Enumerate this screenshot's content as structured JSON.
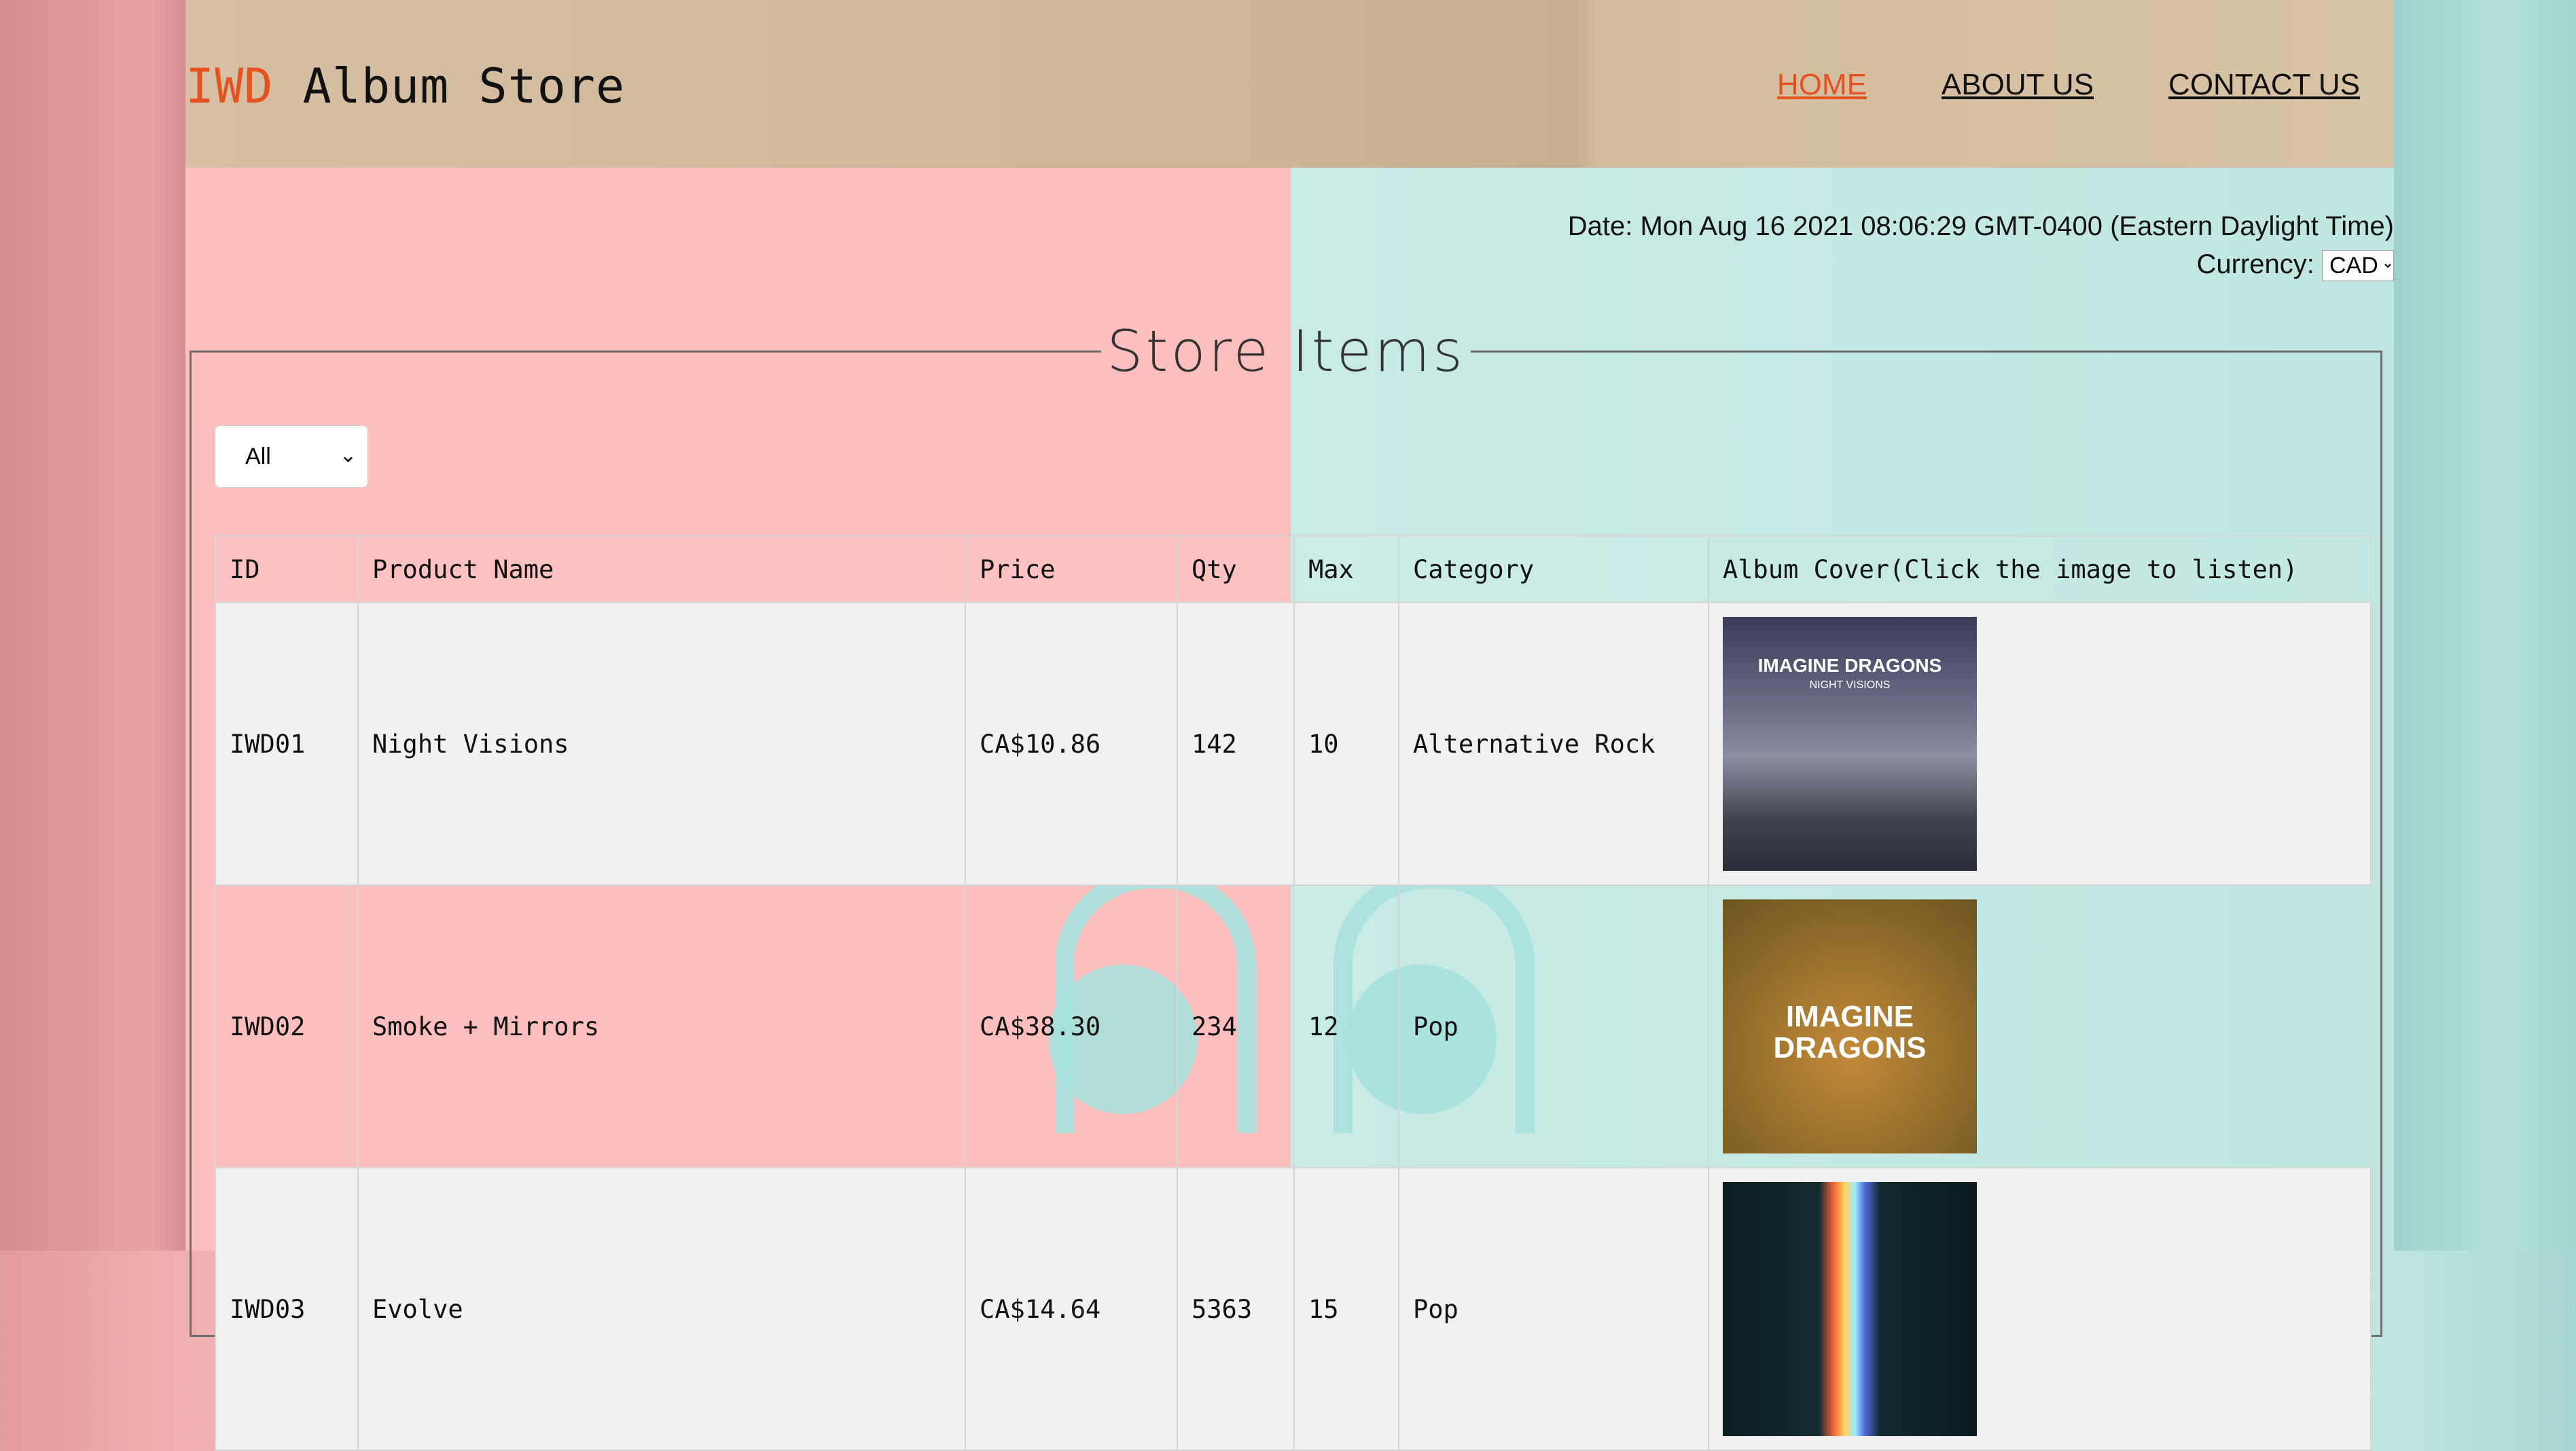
{
  "header": {
    "logo_accent": "IWD",
    "logo_rest": " Album Store",
    "nav": [
      "HOME",
      "ABOUT US",
      "CONTACT US"
    ]
  },
  "info": {
    "date": "Date: Mon Aug 16 2021 08:06:29 GMT-0400 (Eastern Daylight Time)",
    "currency_label": "Currency:",
    "currency_value": "CAD"
  },
  "store": {
    "legend": "Store Items",
    "filter_value": "All",
    "columns": [
      "ID",
      "Product Name",
      "Price",
      "Qty",
      "Max",
      "Category",
      "Album Cover(Click the image to listen)"
    ],
    "rows": [
      {
        "id": "IWD01",
        "name": "Night Visions",
        "price": "CA$10.86",
        "qty": "142",
        "max": "10",
        "category": "Alternative Rock",
        "cover_title": "IMAGINE DRAGONS",
        "cover_sub": "NIGHT VISIONS"
      },
      {
        "id": "IWD02",
        "name": "Smoke + Mirrors",
        "price": "CA$38.30",
        "qty": "234",
        "max": "12",
        "category": "Pop",
        "cover_title": "IMAGINE DRAGONS",
        "cover_sub": ""
      },
      {
        "id": "IWD03",
        "name": "Evolve",
        "price": "CA$14.64",
        "qty": "5363",
        "max": "15",
        "category": "Pop",
        "cover_title": "",
        "cover_sub": ""
      }
    ]
  },
  "colors": {
    "accent": "#e4531f",
    "pink": "#fcbfbe",
    "teal": "#c5e8e3",
    "header": "#d2ba9d"
  }
}
